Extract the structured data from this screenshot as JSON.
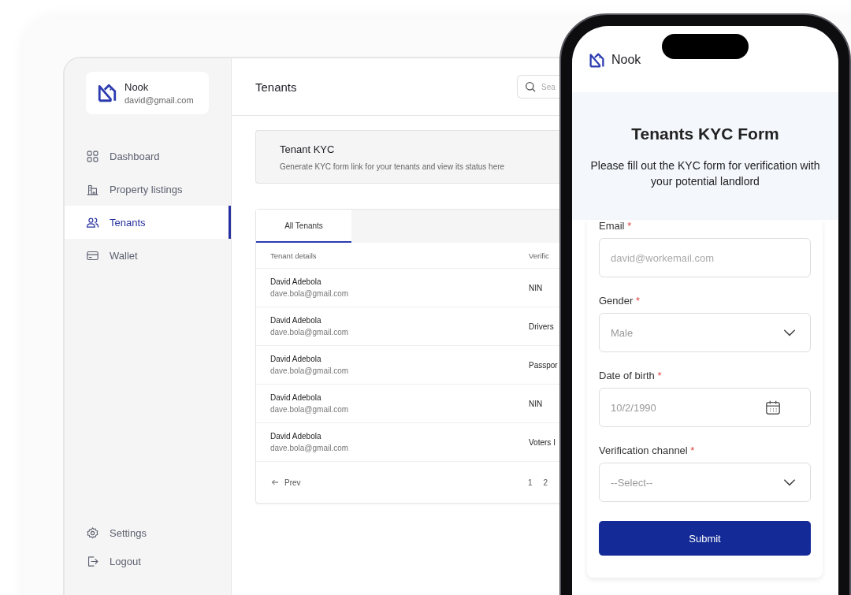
{
  "sidebar": {
    "brand": {
      "name": "Nook",
      "email": "david@gmail.com"
    },
    "items": [
      {
        "label": "Dashboard",
        "selected": false
      },
      {
        "label": "Property listings",
        "selected": false
      },
      {
        "label": "Tenants",
        "selected": true
      },
      {
        "label": "Wallet",
        "selected": false
      }
    ],
    "footer_items": [
      {
        "label": "Settings"
      },
      {
        "label": "Logout"
      }
    ]
  },
  "header": {
    "title": "Tenants",
    "search": {
      "placeholder": "Sea"
    }
  },
  "kyc_banner": {
    "title": "Tenant KYC",
    "description": "Generate KYC form link for your tenants and view its status here"
  },
  "tabs": [
    {
      "label": "All Tenants",
      "selected": true
    }
  ],
  "table": {
    "columns": [
      "Tenant details",
      "Verific"
    ],
    "rows": [
      {
        "name": "David Adebola",
        "email": "dave.bola@gmail.com",
        "verification": "NIN"
      },
      {
        "name": "David Adebola",
        "email": "dave.bola@gmail.com",
        "verification": "Drivers"
      },
      {
        "name": "David Adebola",
        "email": "dave.bola@gmail.com",
        "verification": "Passpor"
      },
      {
        "name": "David Adebola",
        "email": "dave.bola@gmail.com",
        "verification": "NIN"
      },
      {
        "name": "David Adebola",
        "email": "dave.bola@gmail.com",
        "verification": "Voters I"
      }
    ]
  },
  "pagination": {
    "prev": "Prev",
    "pages": [
      {
        "label": "1"
      },
      {
        "label": "2"
      }
    ]
  },
  "phone": {
    "brand": "Nook",
    "form_title": "Tenants KYC Form",
    "form_subtitle": "Please fill out the KYC form for verification with your potential landlord",
    "fields": [
      {
        "kind": "input",
        "label": "Email",
        "required_mark": "*",
        "placeholder": "david@workemail.com"
      },
      {
        "kind": "select",
        "label": "Gender",
        "required_mark": "*",
        "placeholder": "Male"
      },
      {
        "kind": "date",
        "label": "Date of birth",
        "required_mark": "*",
        "placeholder": "10/2/1990"
      },
      {
        "kind": "select",
        "label": "Verification channel",
        "required_mark": "*",
        "placeholder": "--Select--"
      }
    ],
    "submit": "Submit"
  }
}
